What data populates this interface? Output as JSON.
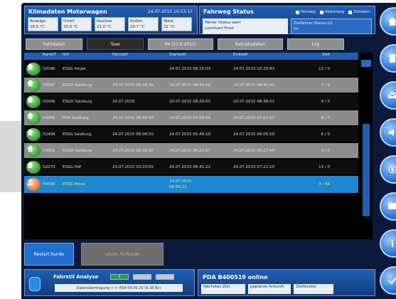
{
  "header_left": {
    "title": "Klimadaten Motorwagen",
    "datetime": "24.07.2015 10:53:17",
    "temps": [
      {
        "label": "Anzeige",
        "value": "18.5 °C"
      },
      {
        "label": "Ortelt",
        "value": "20.0 °C"
      },
      {
        "label": "Auslöse",
        "value": "21.0 °C"
      },
      {
        "label": "Außen",
        "value": "20.7 °C"
      },
      {
        "label": "Ware",
        "value": "22 °C"
      }
    ]
  },
  "header_right": {
    "title": "Fahrweg Status",
    "legend": [
      "Fahrweg",
      "Abstellweg",
      "Zieldaten"
    ],
    "box_a": {
      "line1": "Fahrer      Status   wert",
      "line2": "Leonhard Frost"
    },
    "box_b": {
      "line1": "Zielfahrer     Status  t/s",
      "line2": "t/s"
    }
  },
  "tabs": [
    "Fahrdaten",
    "Taxe",
    "PA (21.8.2015)",
    "Betriebsdaten",
    "Log"
  ],
  "table": {
    "headers": [
      "RunelT",
      "Ort",
      "Fahrzeit",
      "Startzeit",
      "Endzeit",
      "Zeit"
    ],
    "rows": [
      {
        "icon": "house-icon",
        "c1": "52096",
        "c2": "ESSG Ampe",
        "c3": "",
        "c4": "24.07.2015 08:25:03",
        "c5": "24.07.2015 10:20:43",
        "c6": "12 / 0",
        "style": "d"
      },
      {
        "icon": "house-icon",
        "c1": "50097",
        "c2": "ESGD Salzburg",
        "c3": "24.07.2015 08:08:36",
        "c4": "24.07.2015 08:40:08",
        "c5": "24.07.2015 08:40:40",
        "c6": "7 / 0",
        "style": "g"
      },
      {
        "icon": "house-icon",
        "c1": "52006",
        "c2": "ESGD Salzburg",
        "c3": "24.07.2015",
        "c4": "24.07.2015 08:20:50",
        "c5": "24.07.2015 08:38:52",
        "c6": "8 / 0",
        "style": "d"
      },
      {
        "icon": "house-icon",
        "c1": "50005",
        "c2": "FDA Salzburg",
        "c3": "24.07.2015 06:56:50",
        "c4": "24.07.2015 06:59:04",
        "c5": "24.07.2015 07:02:51",
        "c6": "8 / 0",
        "style": "g"
      },
      {
        "icon": "house-icon",
        "c1": "52408",
        "c2": "ESSG Salzburg",
        "c3": "24.07.2015 06:06:50",
        "c4": "24.07.2015 05:49:19",
        "c5": "24.07.2015 06:05:59",
        "c6": "6 / 0",
        "style": "d"
      },
      {
        "icon": "house-icon",
        "c1": "50001",
        "c2": "ESGD Salzburg",
        "c3": "24.07.2015 06:06:50",
        "c4": "24.07.2015 06:22:07",
        "c5": "24.07.2015 06:27:48",
        "c6": "3 / 0",
        "style": "g"
      },
      {
        "icon": "house-icon",
        "c1": "52070",
        "c2": "ESSG Hdf",
        "c3": "24.07.2015 03:20:05",
        "c4": "24.07.2015 06:41:22",
        "c5": "24.07.2015 07:22:10",
        "c6": "13 / 0",
        "style": "d"
      },
      {
        "icon": "person-icon",
        "c1": "50096",
        "c2": "ESSG Mosel",
        "c3": "",
        "c4": "24.07.2015",
        "c5": "",
        "c6": "3 / 88",
        "c4b": "08:59:22",
        "style": "sel"
      }
    ]
  },
  "buttons": {
    "restart": "Restart Runde",
    "disabled": "Lösch. Fil Runde"
  },
  "footer_left": {
    "title": "Fahrstil Analyse",
    "meter1": "1",
    "info": "Datenübertragung <-> PDA 09.06.20 (9.38.Nc)"
  },
  "footer_right": {
    "title": "PDA B400519 online",
    "boxes": [
      "Nächstes Ziel",
      "geplante Ankunft",
      "Zielfenster"
    ]
  },
  "sidebar": [
    "home-icon",
    "document-icon",
    "mail-icon",
    "sound-icon",
    "compass-icon",
    "screen-icon",
    "info-icon",
    "check-icon"
  ]
}
